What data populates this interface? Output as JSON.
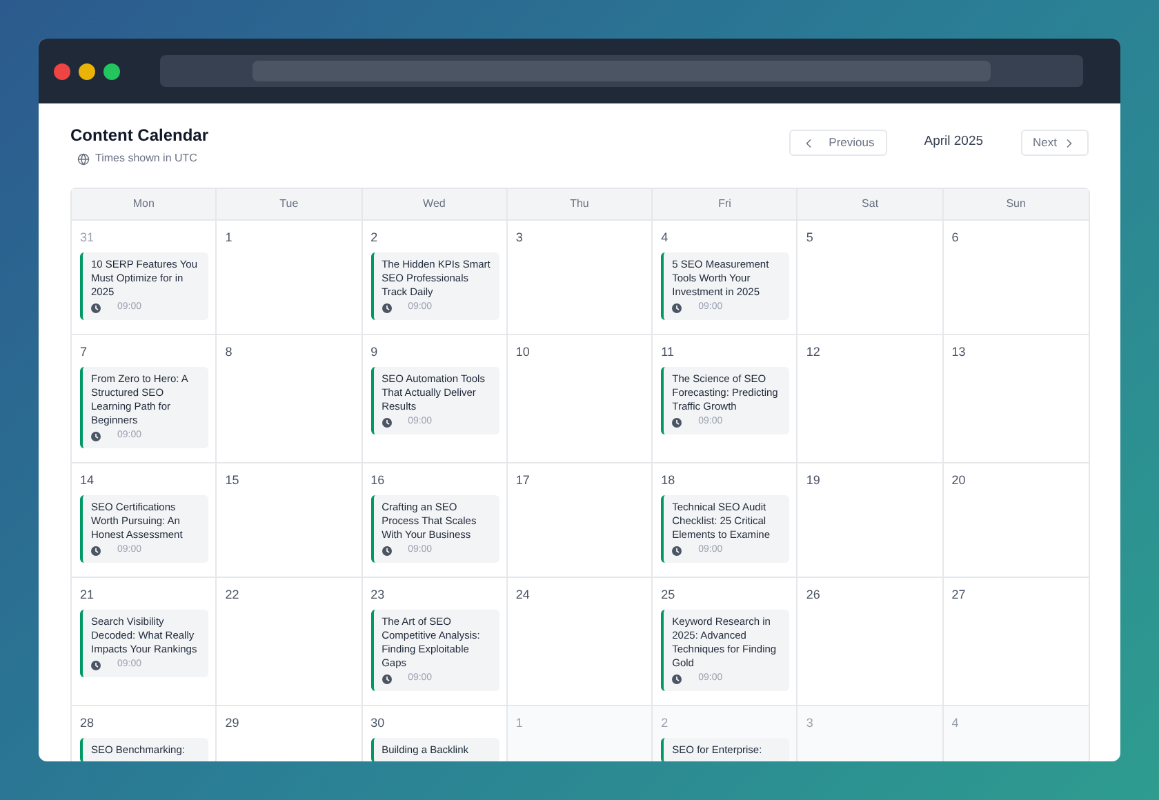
{
  "header": {
    "title": "Content Calendar",
    "timezone_note": "Times shown in UTC"
  },
  "navigation": {
    "previous": "Previous",
    "month": "April 2025",
    "next": "Next"
  },
  "weekdays": [
    "Mon",
    "Tue",
    "Wed",
    "Thu",
    "Fri",
    "Sat",
    "Sun"
  ],
  "weeks": [
    [
      {
        "date": "31",
        "in_month": false,
        "events": [
          {
            "title": "10 SERP Features You Must Optimize for in 2025",
            "time": "09:00"
          }
        ]
      },
      {
        "date": "1",
        "in_month": true
      },
      {
        "date": "2",
        "in_month": true,
        "events": [
          {
            "title": "The Hidden KPIs Smart SEO Professionals Track Daily",
            "time": "09:00"
          }
        ]
      },
      {
        "date": "3",
        "in_month": true
      },
      {
        "date": "4",
        "in_month": true,
        "events": [
          {
            "title": "5 SEO Measurement Tools Worth Your Investment in 2025",
            "time": "09:00"
          }
        ]
      },
      {
        "date": "5",
        "in_month": true
      },
      {
        "date": "6",
        "in_month": true
      }
    ],
    [
      {
        "date": "7",
        "in_month": true,
        "events": [
          {
            "title": "From Zero to Hero: A Structured SEO Learning Path for Beginners",
            "time": "09:00"
          }
        ]
      },
      {
        "date": "8",
        "in_month": true
      },
      {
        "date": "9",
        "in_month": true,
        "events": [
          {
            "title": "SEO Automation Tools That Actually Deliver Results",
            "time": "09:00"
          }
        ]
      },
      {
        "date": "10",
        "in_month": true
      },
      {
        "date": "11",
        "in_month": true,
        "events": [
          {
            "title": "The Science of SEO Forecasting: Predicting Traffic Growth",
            "time": "09:00"
          }
        ]
      },
      {
        "date": "12",
        "in_month": true
      },
      {
        "date": "13",
        "in_month": true
      }
    ],
    [
      {
        "date": "14",
        "in_month": true,
        "events": [
          {
            "title": "SEO Certifications Worth Pursuing: An Honest Assessment",
            "time": "09:00"
          }
        ]
      },
      {
        "date": "15",
        "in_month": true
      },
      {
        "date": "16",
        "in_month": true,
        "events": [
          {
            "title": "Crafting an SEO Process That Scales With Your Business",
            "time": "09:00"
          }
        ]
      },
      {
        "date": "17",
        "in_month": true
      },
      {
        "date": "18",
        "in_month": true,
        "events": [
          {
            "title": "Technical SEO Audit Checklist: 25 Critical Elements to Examine",
            "time": "09:00"
          }
        ]
      },
      {
        "date": "19",
        "in_month": true
      },
      {
        "date": "20",
        "in_month": true
      }
    ],
    [
      {
        "date": "21",
        "in_month": true,
        "events": [
          {
            "title": "Search Visibility Decoded: What Really Impacts Your Rankings",
            "time": "09:00"
          }
        ]
      },
      {
        "date": "22",
        "in_month": true
      },
      {
        "date": "23",
        "in_month": true,
        "events": [
          {
            "title": "The Art of SEO Competitive Analysis: Finding Exploitable Gaps",
            "time": "09:00"
          }
        ]
      },
      {
        "date": "24",
        "in_month": true
      },
      {
        "date": "25",
        "in_month": true,
        "events": [
          {
            "title": "Keyword Research in 2025: Advanced Techniques for Finding Gold",
            "time": "09:00"
          }
        ]
      },
      {
        "date": "26",
        "in_month": true
      },
      {
        "date": "27",
        "in_month": true
      }
    ],
    [
      {
        "date": "28",
        "in_month": true,
        "events": [
          {
            "title": "SEO Benchmarking:"
          }
        ]
      },
      {
        "date": "29",
        "in_month": true
      },
      {
        "date": "30",
        "in_month": true,
        "events": [
          {
            "title": "Building a Backlink"
          }
        ]
      },
      {
        "date": "1",
        "in_month": false
      },
      {
        "date": "2",
        "in_month": false,
        "events": [
          {
            "title": "SEO for Enterprise:"
          }
        ]
      },
      {
        "date": "3",
        "in_month": false
      },
      {
        "date": "4",
        "in_month": false
      }
    ]
  ]
}
